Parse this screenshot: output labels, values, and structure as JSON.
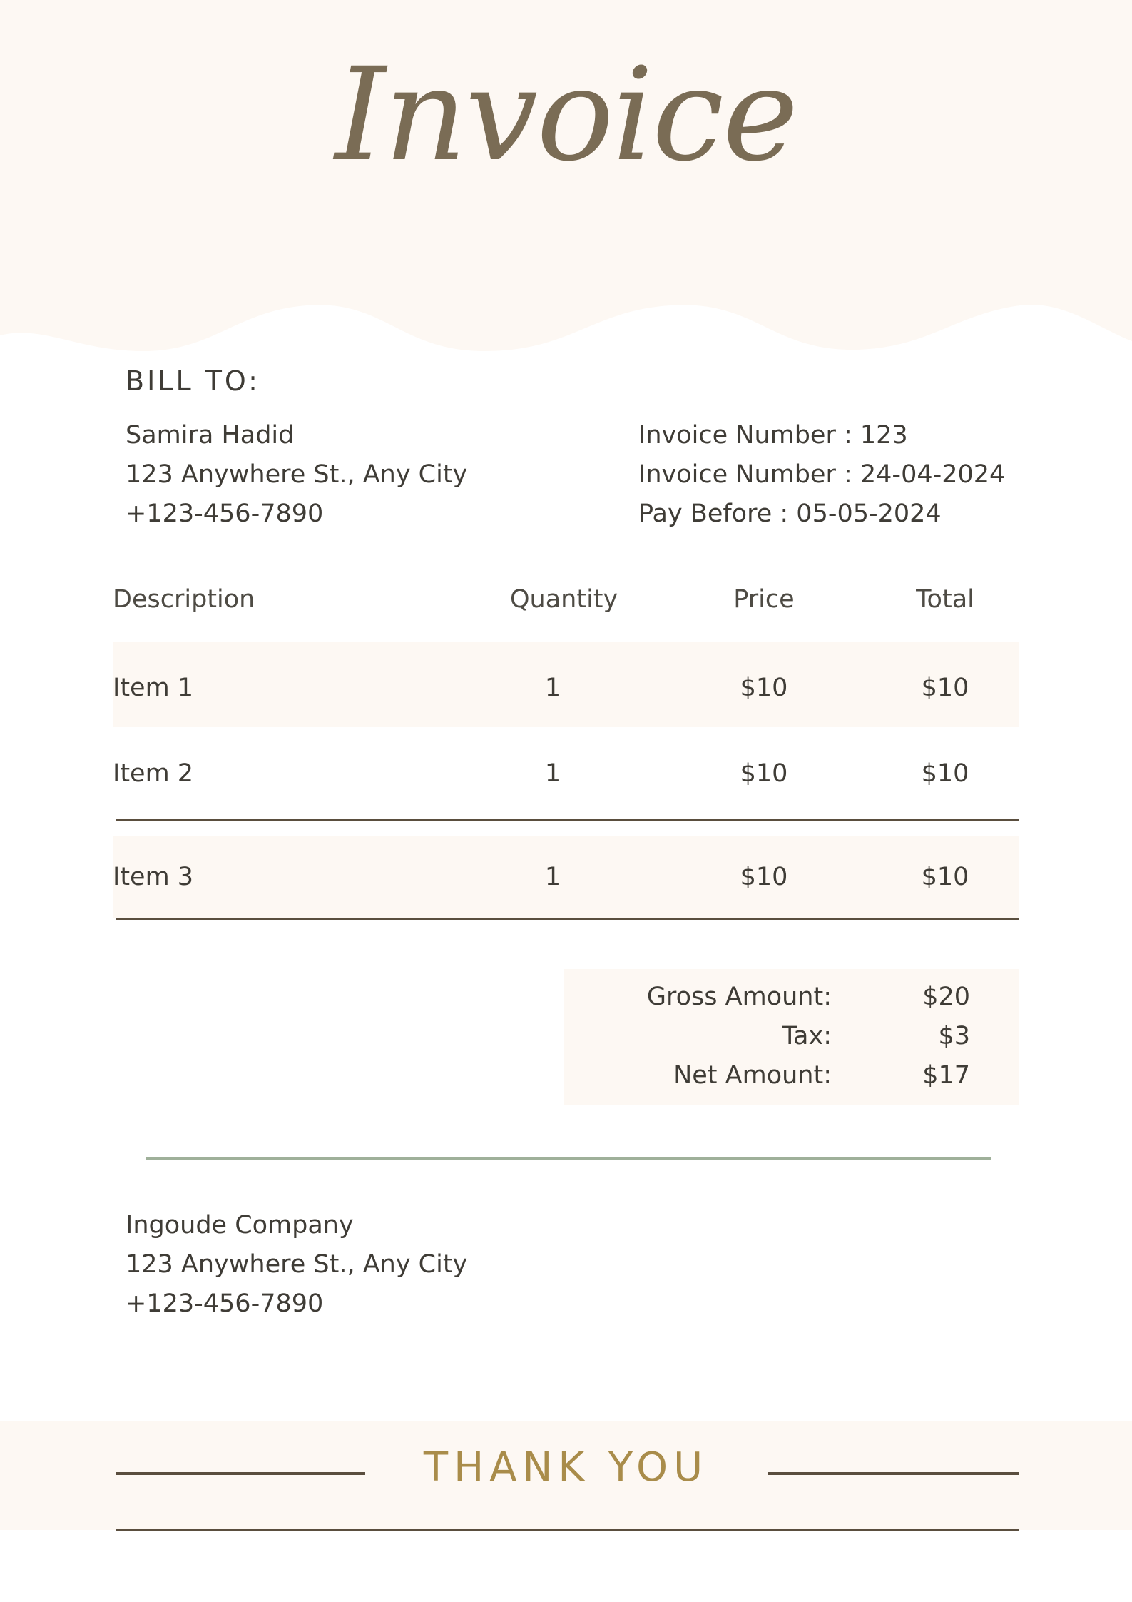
{
  "colors": {
    "header_background": "#fdf8f3",
    "title_ink": "#7a6c55",
    "text": "#3f3c36",
    "rule_dark": "#5a4e3e",
    "rule_green": "#9fb09a",
    "thank_you_gold": "#a98c4a"
  },
  "header": {
    "title": "Invoice"
  },
  "bill_to": {
    "heading": "BILL TO:",
    "name": "Samira Hadid",
    "address": "123 Anywhere St., Any City",
    "phone": "+123-456-7890"
  },
  "invoice_meta": {
    "number": "Invoice Number : 123",
    "date": "Invoice Number : 24-04-2024",
    "pay_before": "Pay Before : 05-05-2024"
  },
  "table": {
    "headers": [
      "Description",
      "Quantity",
      "Price",
      "Total"
    ],
    "rows": [
      [
        "Item 1",
        "1",
        "$10",
        "$10"
      ],
      [
        "Item 2",
        "1",
        "$10",
        "$10"
      ],
      [
        "Item 3",
        "1",
        "$10",
        "$10"
      ]
    ]
  },
  "totals": {
    "gross_label": "Gross Amount:",
    "gross_value": "$20",
    "tax_label": "Tax:",
    "tax_value": "$3",
    "net_label": "Net Amount:",
    "net_value": "$17"
  },
  "company": {
    "name": "Ingoude Company",
    "address": "123 Anywhere St., Any City",
    "phone": "+123-456-7890"
  },
  "footer": {
    "thank_you": "THANK YOU"
  }
}
